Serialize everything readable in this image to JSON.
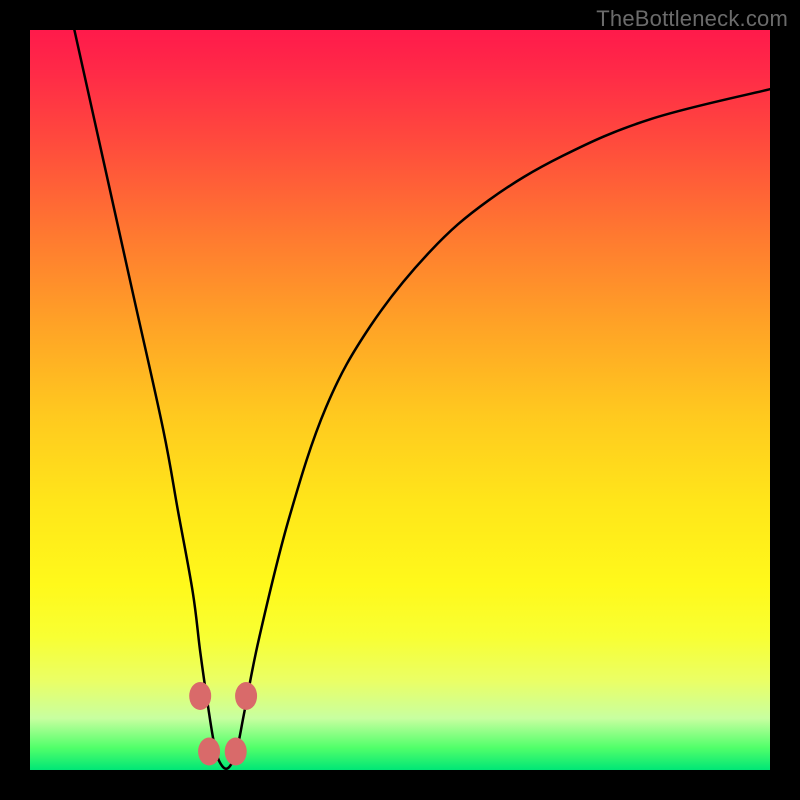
{
  "watermark": "TheBottleneck.com",
  "chart_data": {
    "type": "line",
    "title": "",
    "xlabel": "",
    "ylabel": "",
    "xlim": [
      0,
      100
    ],
    "ylim": [
      0,
      100
    ],
    "series": [
      {
        "name": "bottleneck-curve",
        "x": [
          6,
          10,
          14,
          18,
          20,
          22,
          23,
          24,
          25,
          26,
          27,
          28,
          29,
          31,
          35,
          40,
          46,
          54,
          62,
          72,
          84,
          100
        ],
        "values": [
          100,
          82,
          64,
          46,
          35,
          24,
          16,
          9,
          3,
          0.5,
          0.5,
          3,
          8,
          18,
          34,
          49,
          60,
          70,
          77,
          83,
          88,
          92
        ]
      }
    ],
    "markers": [
      {
        "x": 23.0,
        "y": 10.0
      },
      {
        "x": 24.2,
        "y": 2.5
      },
      {
        "x": 27.8,
        "y": 2.5
      },
      {
        "x": 29.2,
        "y": 10.0
      }
    ],
    "marker_color": "#d96a6a",
    "curve_stroke": "#000000"
  }
}
